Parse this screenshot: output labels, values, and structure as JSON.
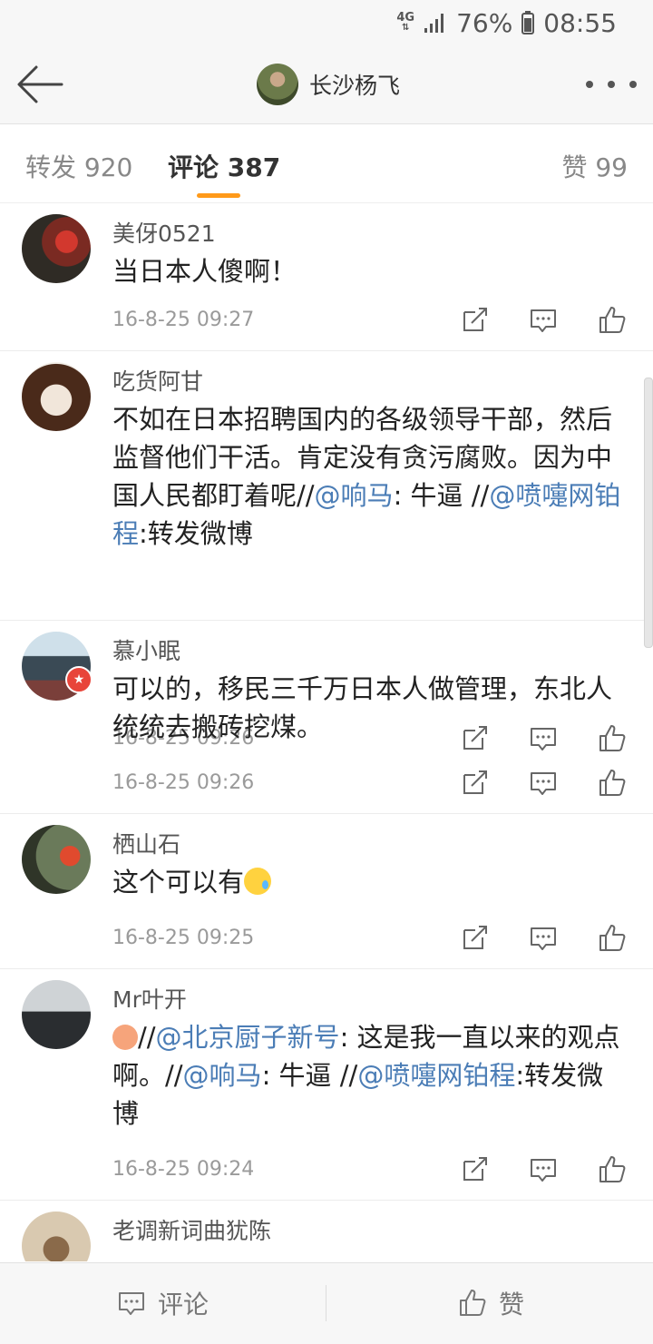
{
  "status": {
    "network": "4G",
    "battery": "76%",
    "time": "08:55"
  },
  "header": {
    "title": "长沙杨飞"
  },
  "tabs": [
    {
      "label": "转发 920",
      "active": false
    },
    {
      "label": "评论 387",
      "active": true
    },
    {
      "label": "赞 99",
      "active": false
    }
  ],
  "comments": [
    {
      "user": "美伢0521",
      "text_parts": [
        {
          "t": "当日本人傻啊！"
        }
      ],
      "time": "16-8-25 09:27"
    },
    {
      "user": "吃货阿甘",
      "text_parts": [
        {
          "t": "不如在日本招聘国内的各级领导干部，然后监督他们干活。肯定没有贪污腐败。因为中国人民都盯着呢//"
        },
        {
          "m": "@响马"
        },
        {
          "t": ": 牛逼 //"
        },
        {
          "m": "@喷嚏网铂程"
        },
        {
          "t": ":转发微博"
        }
      ],
      "time": "16-8-25 09:26"
    },
    {
      "user": "慕小眠",
      "text_parts": [
        {
          "t": "可以的，移民三千万日本人做管理，东北人统统去搬砖挖煤。"
        }
      ],
      "time": "16-8-25 09:26"
    },
    {
      "user": "栖山石",
      "text_parts": [
        {
          "t": "这个可以有"
        },
        {
          "e": "sad"
        }
      ],
      "time": "16-8-25 09:25"
    },
    {
      "user": "Mr叶开",
      "text_parts": [
        {
          "e": "monkey"
        },
        {
          "t": "//"
        },
        {
          "m": "@北京厨子新号"
        },
        {
          "t": ": 这是我一直以来的观点啊。//"
        },
        {
          "m": "@响马"
        },
        {
          "t": ": 牛逼 //"
        },
        {
          "m": "@喷嚏网铂程"
        },
        {
          "t": ":转发微博"
        }
      ],
      "time": "16-8-25 09:24"
    },
    {
      "user": "老调新词曲犹陈",
      "text_parts": [],
      "time": ""
    }
  ],
  "bottom": {
    "comment": "评论",
    "like": "赞"
  },
  "colors": {
    "accent": "#ff9a1a",
    "mention": "#4b7db6"
  }
}
